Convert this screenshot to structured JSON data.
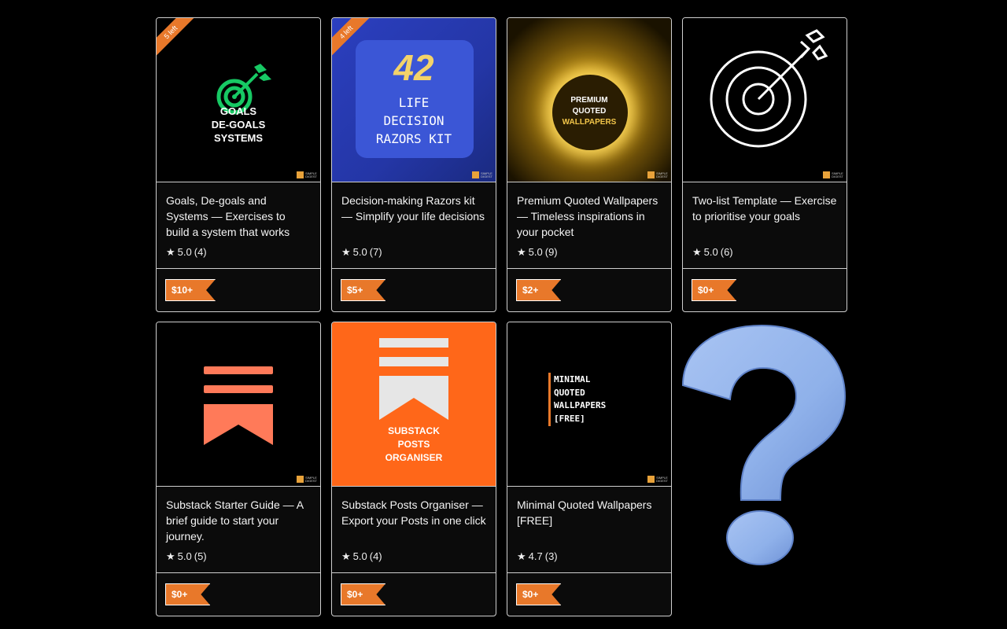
{
  "cards": [
    {
      "title": "Goals, De-goals and Systems — Exercises to build a system that works",
      "rating": "5.0",
      "count": "(4)",
      "price": "$10+",
      "ribbon": "5 left",
      "thumb_text": [
        "GOALS",
        "DE-GOALS",
        "SYSTEMS"
      ]
    },
    {
      "title": "Decision-making Razors kit — Simplify your life decisions",
      "rating": "5.0",
      "count": "(7)",
      "price": "$5+",
      "ribbon": "4 left",
      "thumb_big": "42",
      "thumb_text": [
        "LIFE",
        "DECISION",
        "RAZORS KIT"
      ]
    },
    {
      "title": "Premium Quoted Wallpapers — Timeless inspirations in your pocket",
      "rating": "5.0",
      "count": "(9)",
      "price": "$2+",
      "thumb_text": [
        "PREMIUM",
        "QUOTED",
        "WALLPAPERS"
      ]
    },
    {
      "title": "Two-list Template — Exercise to prioritise your goals",
      "rating": "5.0",
      "count": "(6)",
      "price": "$0+"
    },
    {
      "title": "Substack Starter Guide — A brief guide to start your journey.",
      "rating": "5.0",
      "count": "(5)",
      "price": "$0+"
    },
    {
      "title": "Substack Posts Organiser — Export your Posts in one click",
      "rating": "5.0",
      "count": "(4)",
      "price": "$0+",
      "thumb_text": [
        "SUBSTACK",
        "POSTS",
        "ORGANISER"
      ]
    },
    {
      "title": "Minimal Quoted Wallpapers [FREE]",
      "rating": "4.7",
      "count": "(3)",
      "price": "$0+",
      "thumb_text": [
        "MINIMAL",
        "QUOTED",
        "WALLPAPERS",
        "[FREE]"
      ]
    }
  ],
  "icons": {
    "star": "star-icon",
    "question": "question-mark-icon"
  },
  "colors": {
    "accent": "#e8782a",
    "substack_orange": "#ff6719",
    "question_blue": "#8fb1ea"
  }
}
